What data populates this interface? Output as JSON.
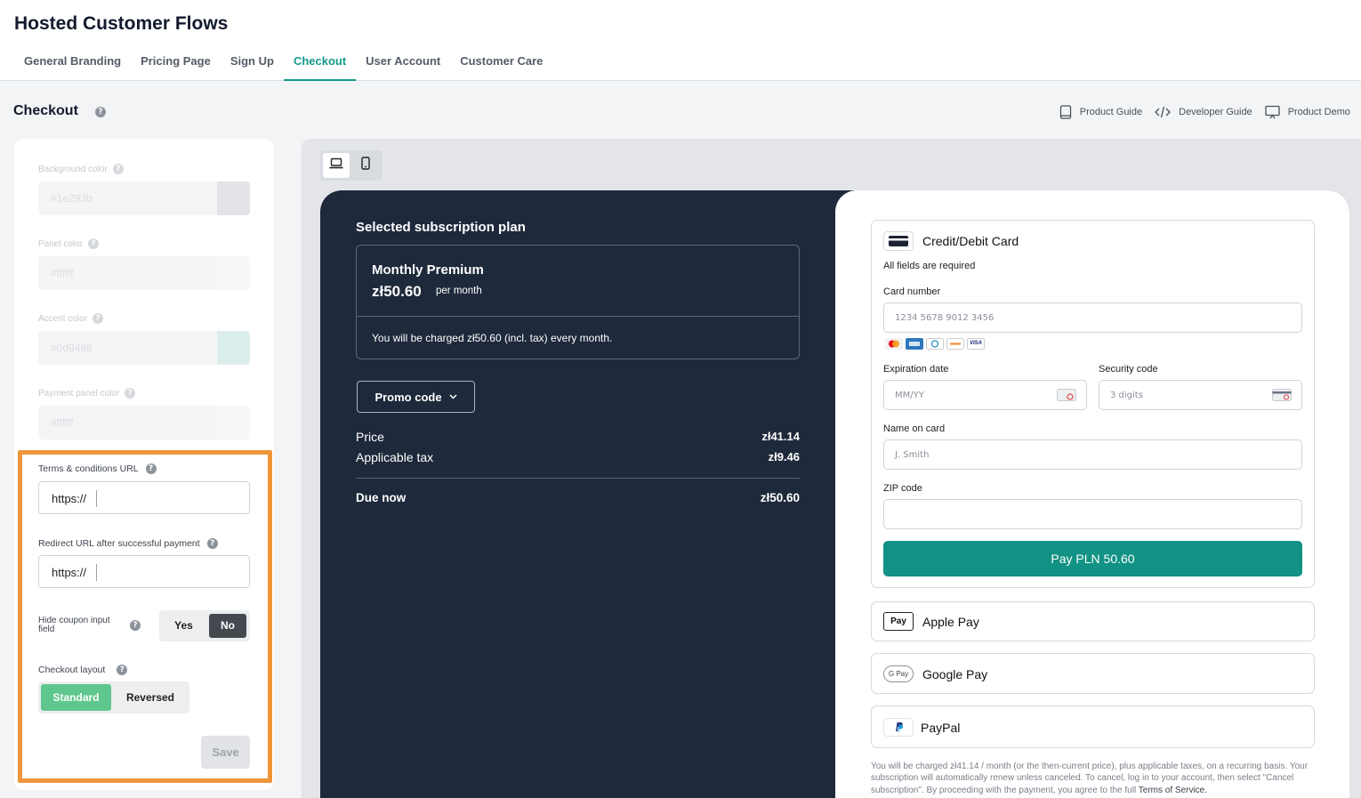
{
  "header": {
    "title": "Hosted Customer Flows",
    "tabs": [
      "General Branding",
      "Pricing Page",
      "Sign Up",
      "Checkout",
      "User Account",
      "Customer Care"
    ],
    "active_tab": "Checkout"
  },
  "section": {
    "title": "Checkout",
    "guides": [
      "Product Guide",
      "Developer Guide",
      "Product Demo"
    ]
  },
  "settings": {
    "background_color": {
      "label": "Background color",
      "value": "#1e293b",
      "swatch": "#aeb4bf"
    },
    "panel_color": {
      "label": "Panel color",
      "value": "#ffffff",
      "swatch": "#e9ebee"
    },
    "accent_color": {
      "label": "Accent color",
      "value": "#0d9488",
      "swatch": "#9ecfcb"
    },
    "payment_panel_color": {
      "label": "Payment panel color",
      "value": "#ffffff",
      "swatch": "#e9ebee"
    },
    "terms_url": {
      "label": "Terms & conditions URL",
      "value": "https://"
    },
    "redirect_url": {
      "label": "Redirect URL after successful payment",
      "value": "https://"
    },
    "hide_coupon": {
      "label": "Hide coupon input field",
      "yes": "Yes",
      "no": "No",
      "selected": "No"
    },
    "layout": {
      "label": "Checkout layout",
      "options": [
        "Standard",
        "Reversed"
      ],
      "selected": "Standard"
    },
    "save_label": "Save"
  },
  "preview": {
    "heading": "Selected subscription plan",
    "plan_name": "Monthly Premium",
    "plan_price": "zł50.60",
    "plan_period": "per month",
    "charge_note": "You will be charged zł50.60 (incl. tax) every month.",
    "promo_label": "Promo code",
    "price_label": "Price",
    "price_value": "zł41.14",
    "tax_label": "Applicable tax",
    "tax_value": "zł9.46",
    "due_label": "Due now",
    "due_value": "zł50.60",
    "card": {
      "title": "Credit/Debit Card",
      "required": "All fields are required",
      "number_label": "Card number",
      "number_placeholder": "1234 5678 9012 3456",
      "exp_label": "Expiration date",
      "exp_placeholder": "MM/YY",
      "cvc_label": "Security code",
      "cvc_placeholder": "3 digits",
      "name_label": "Name on card",
      "name_placeholder": "J. Smith",
      "zip_label": "ZIP code",
      "zip_placeholder": "",
      "brands": [
        "mastercard-icon",
        "amex-icon",
        "diners-icon",
        "discover-icon",
        "visa-icon"
      ],
      "visa_text": "VISA"
    },
    "pay_label": "Pay PLN 50.60",
    "methods": {
      "apple": "Apple Pay",
      "apple_badge": "Pay",
      "google": "Google Pay",
      "google_badge": "G Pay",
      "paypal": "PayPal"
    },
    "fine_print": "You will be charged zł41.14 / month (or the then-current price), plus applicable taxes, on a recurring basis. Your subscription will automatically renew unless canceled. To cancel, log in to your account, then select \"Cancel subscription\". By proceeding with the payment, you agree to the full ",
    "fine_link": "Terms of Service."
  },
  "colors": {
    "accent": "#149a8c",
    "dark_panel": "#1e293b",
    "pay_button": "#119284",
    "highlight": "#f0953a",
    "standard_button": "#5fc78d"
  }
}
